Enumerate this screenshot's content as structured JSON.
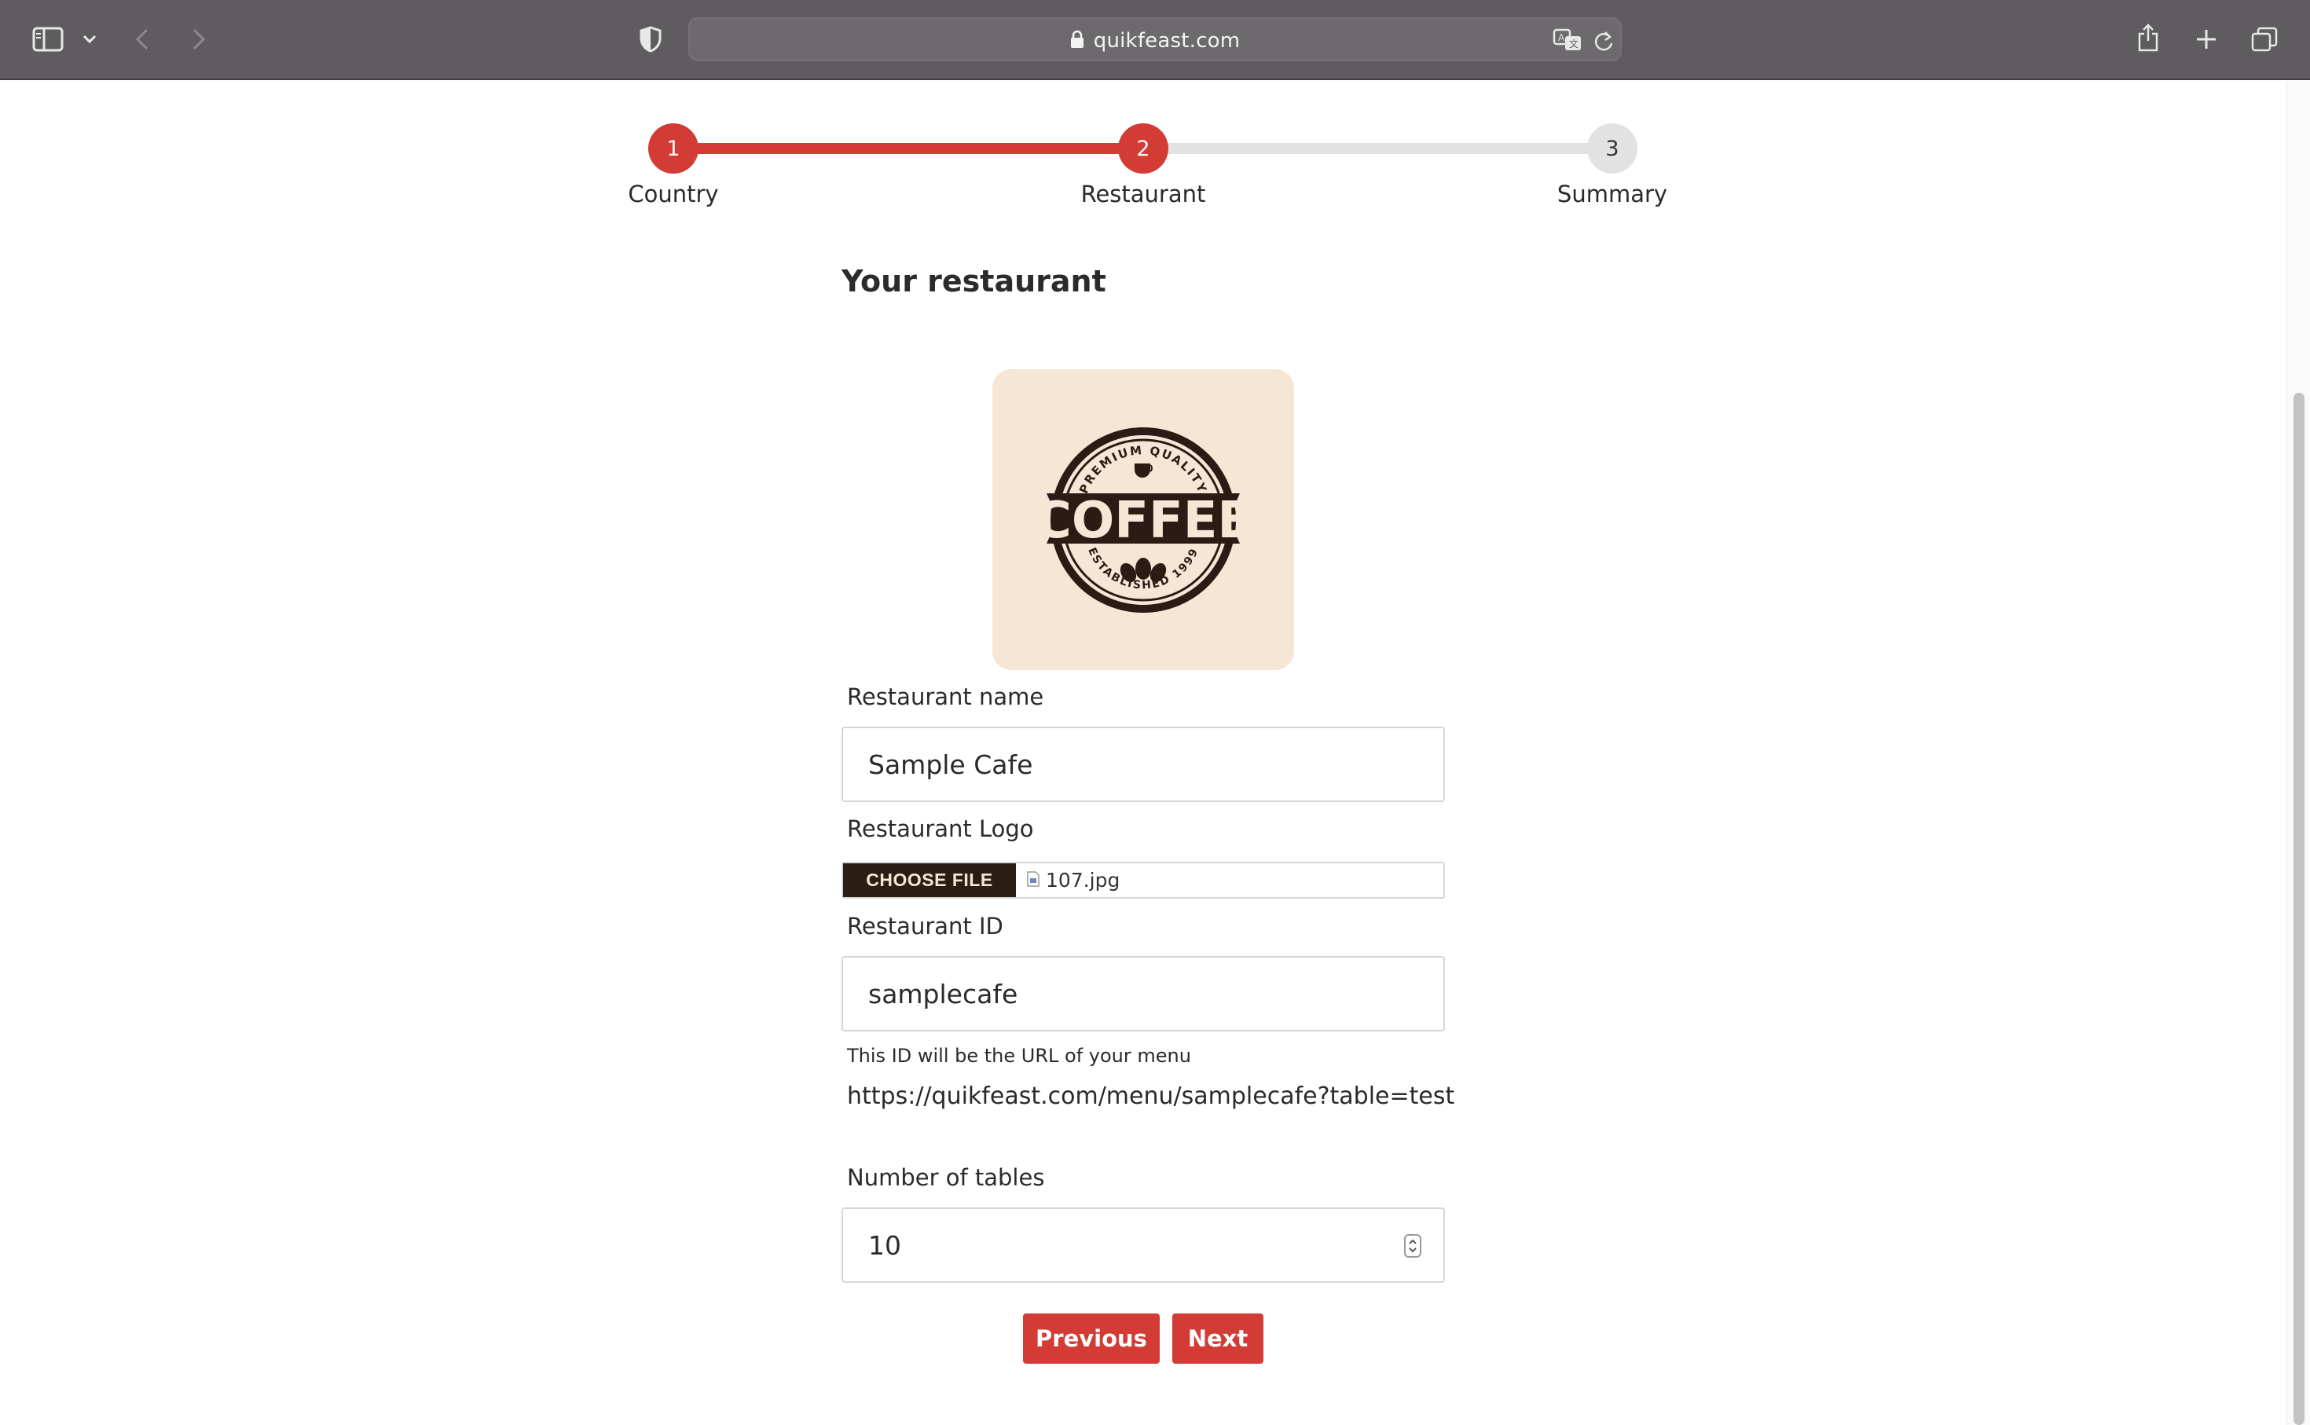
{
  "browser": {
    "url": "quikfeast.com"
  },
  "stepper": {
    "steps": [
      {
        "number": "1",
        "label": "Country"
      },
      {
        "number": "2",
        "label": "Restaurant"
      },
      {
        "number": "3",
        "label": "Summary"
      }
    ],
    "active_step": 2
  },
  "form": {
    "heading": "Your restaurant",
    "logo": {
      "text_main": "COFFEE",
      "text_top": "PREMIUM QUALITY",
      "text_bottom": "ESTABLISHED 1999"
    },
    "restaurant_name": {
      "label": "Restaurant name",
      "value": "Sample Cafe"
    },
    "restaurant_logo": {
      "label": "Restaurant Logo",
      "button_label": "CHOOSE FILE",
      "file_name": "107.jpg"
    },
    "restaurant_id": {
      "label": "Restaurant ID",
      "value": "samplecafe",
      "hint": "This ID will be the URL of your menu",
      "url_preview": "https://quikfeast.com/menu/samplecafe?table=test"
    },
    "number_of_tables": {
      "label": "Number of tables",
      "value": "10"
    },
    "previous_label": "Previous",
    "next_label": "Next"
  },
  "colors": {
    "accent": "#d33b35",
    "inactive_step": "#e2e2e2",
    "logo_background": "#f5e6d6",
    "file_button": "#2a1d12"
  },
  "icons": [
    "sidebar-icon",
    "chevron-down-icon",
    "back-icon",
    "forward-icon",
    "shield-icon",
    "lock-icon",
    "translate-icon",
    "reload-icon",
    "share-icon",
    "plus-icon",
    "tabs-icon",
    "file-icon",
    "spin-arrows-icon"
  ]
}
